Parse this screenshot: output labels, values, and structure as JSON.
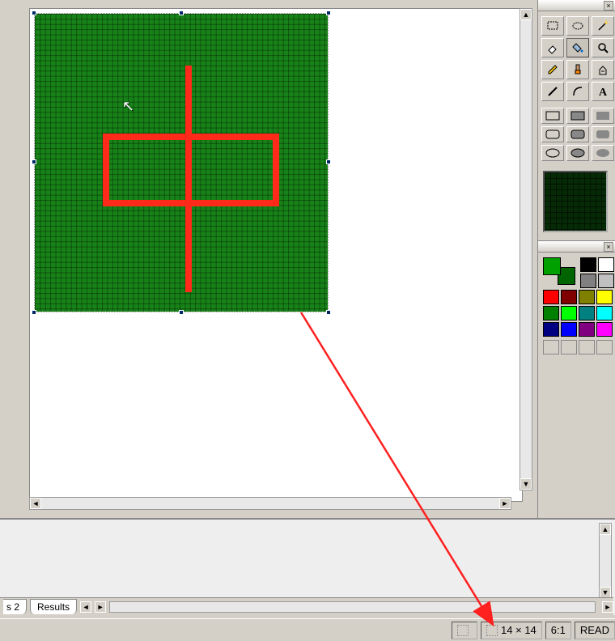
{
  "canvas": {
    "grid_color": "#178217",
    "red_color": "#ff2a1a"
  },
  "tools": {
    "row1": [
      "rect-select-icon",
      "freeform-select-icon",
      "wand-icon"
    ],
    "row2": [
      "eraser-icon",
      "fill-icon",
      "zoom-icon"
    ],
    "row3": [
      "pencil-icon",
      "brush-icon",
      "clone-icon"
    ],
    "row4": [
      "line-icon",
      "curve-icon",
      "text-icon"
    ],
    "active": "fill-icon"
  },
  "palette": {
    "foreground": "#00a000",
    "background": "#006400",
    "swatches": [
      "#000000",
      "#ffffff",
      "#808080",
      "#c0c0c0",
      "#ff0000",
      "#800000",
      "#808000",
      "#ffff00",
      "#008000",
      "#00ff00",
      "#008080",
      "#00ffff",
      "#000080",
      "#0000ff",
      "#800080",
      "#ff00ff"
    ]
  },
  "tabs": {
    "partial": "s 2",
    "results": "Results"
  },
  "status": {
    "dimensions": "14 × 14",
    "zoom": "6:1",
    "mode": "READ"
  }
}
